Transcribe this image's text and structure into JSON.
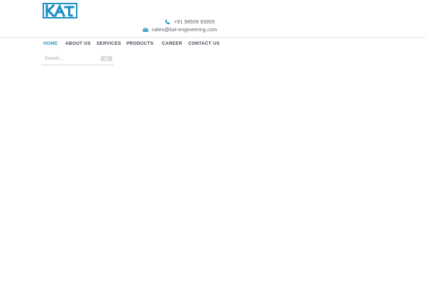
{
  "brand": {
    "logo_text": "KAT",
    "logo_color": "#1d8fc4"
  },
  "contact": {
    "phone": "+91 98509 83955",
    "email": "sales@kat-engineering.com",
    "icon_color": "#1d8fc4"
  },
  "nav": {
    "items": [
      {
        "label": "HOME",
        "active": true
      },
      {
        "label": "ABOUT US"
      },
      {
        "label": "SERVICES"
      },
      {
        "label": "PRODUCTS"
      },
      {
        "label": "CAREER"
      },
      {
        "label": "CONTACT US"
      }
    ],
    "active_color": "#2391c5"
  },
  "search": {
    "placeholder": "Search...",
    "button_icon": "search-icon"
  }
}
